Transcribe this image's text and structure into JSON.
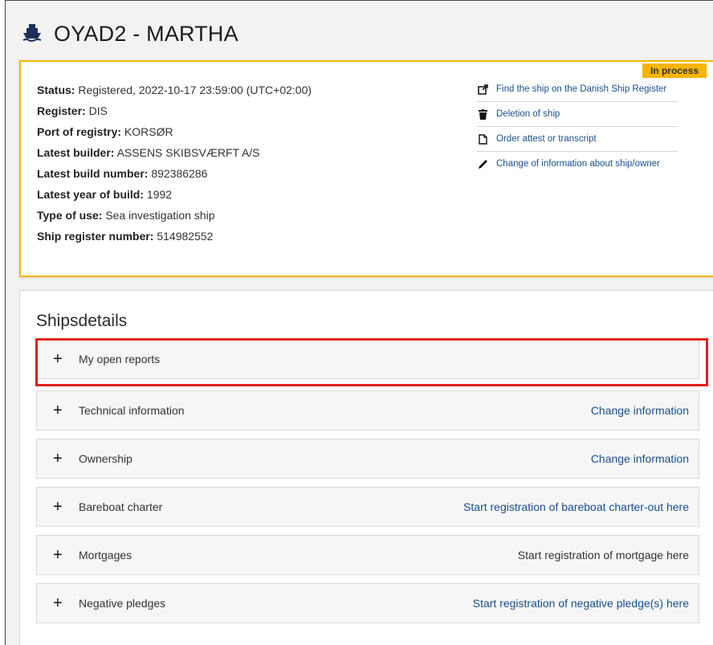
{
  "header": {
    "title": "OYAD2 - MARTHA",
    "ship_icon": "ship-icon"
  },
  "status_box": {
    "badge": "In process",
    "facts": [
      {
        "label": "Status:",
        "value": "Registered, 2022-10-17 23:59:00 (UTC+02:00)"
      },
      {
        "label": "Register:",
        "value": "DIS"
      },
      {
        "label": "Port of registry:",
        "value": "KORSØR"
      },
      {
        "label": "Latest builder:",
        "value": "ASSENS SKIBSVÆRFT A/S"
      },
      {
        "label": "Latest build number:",
        "value": "892386286"
      },
      {
        "label": "Latest year of build:",
        "value": "1992"
      },
      {
        "label": "Type of use:",
        "value": "Sea investigation ship"
      },
      {
        "label": "Ship register number:",
        "value": "514982552"
      }
    ],
    "actions": [
      {
        "label": "Find the ship on the Danish Ship Register",
        "icon": "external-link-icon"
      },
      {
        "label": "Deletion of ship",
        "icon": "trash-icon"
      },
      {
        "label": "Order attest or transcript",
        "icon": "document-icon"
      },
      {
        "label": "Change of information about ship/owner",
        "icon": "pencil-icon"
      }
    ]
  },
  "details": {
    "title": "Shipsdetails",
    "sections": [
      {
        "label": "My open reports",
        "action": ""
      },
      {
        "label": "Technical information",
        "action": "Change information"
      },
      {
        "label": "Ownership",
        "action": "Change information"
      },
      {
        "label": "Bareboat charter",
        "action": "Start registration of bareboat charter-out here"
      },
      {
        "label": "Mortgages",
        "action": "Start registration of mortgage here"
      },
      {
        "label": "Negative pledges",
        "action": "Start registration of negative pledge(s) here"
      }
    ],
    "expand_symbol": "+"
  },
  "colors": {
    "accent": "#f7b500",
    "link": "#1a4f8b",
    "highlight": "#e0201f"
  }
}
